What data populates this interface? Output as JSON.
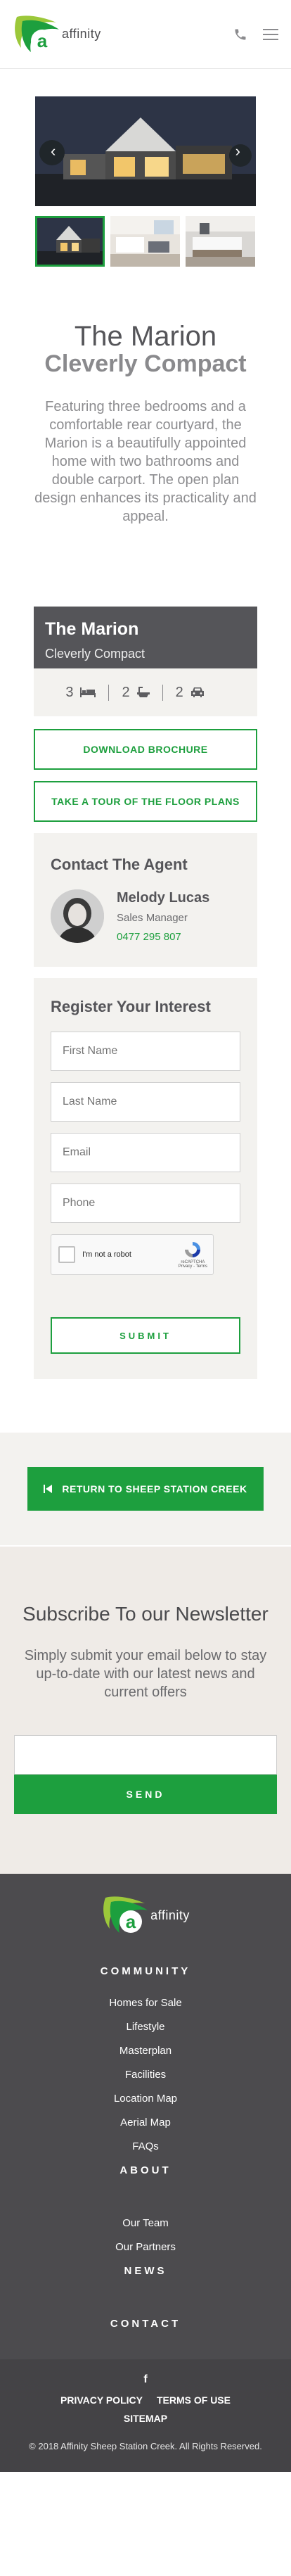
{
  "brand": {
    "name": "affinity",
    "accent": "#1d9f3e"
  },
  "header": {
    "phone_icon": "phone-icon",
    "menu_icon": "hamburger-icon"
  },
  "gallery": {
    "prev_icon": "chevron-left-icon",
    "next_icon": "chevron-right-icon",
    "thumbs": [
      "exterior-dusk",
      "living-room",
      "kitchen"
    ]
  },
  "intro": {
    "title": "The Marion",
    "subtitle": "Cleverly Compact",
    "description": "Featuring three bedrooms and a comfortable rear courtyard, the Marion is a beautifully appointed home with two bathrooms and double carport. The open plan design enhances its practicality and appeal."
  },
  "spec": {
    "title": "The Marion",
    "subtitle": "Cleverly Compact",
    "items": [
      {
        "value": "3",
        "icon": "bed-icon"
      },
      {
        "value": "2",
        "icon": "bath-icon"
      },
      {
        "value": "2",
        "icon": "car-icon"
      }
    ]
  },
  "actions": {
    "download": "DOWNLOAD BROCHURE",
    "tour": "TAKE A TOUR OF THE FLOOR PLANS"
  },
  "agent": {
    "heading": "Contact The Agent",
    "name": "Melody Lucas",
    "role": "Sales Manager",
    "phone": "0477 295 807"
  },
  "register": {
    "heading": "Register Your Interest",
    "fields": {
      "first": "First Name",
      "last": "Last Name",
      "email": "Email",
      "phone": "Phone"
    },
    "captcha_label": "I'm not a robot",
    "captcha_brand": "reCAPTCHA",
    "captcha_terms": "Privacy - Terms",
    "submit": "SUBMIT"
  },
  "return": {
    "label": "RETURN TO SHEEP STATION CREEK"
  },
  "newsletter": {
    "heading": "Subscribe To our Newsletter",
    "text": "Simply submit your email below to stay up-to-date with our latest news and current offers",
    "send": "SEND"
  },
  "footer": {
    "community_heading": "COMMUNITY",
    "community_links": [
      "Homes for Sale",
      "Lifestyle",
      "Masterplan",
      "Facilities",
      "Location Map",
      "Aerial Map",
      "FAQs"
    ],
    "about_heading": "ABOUT",
    "about_links": [
      "Our Team",
      "Our Partners"
    ],
    "news_heading": "NEWS",
    "contact_heading": "CONTACT",
    "facebook": "f",
    "privacy": "PRIVACY POLICY",
    "terms": "TERMS OF USE",
    "sitemap": "SITEMAP",
    "copyright": "© 2018 Affinity Sheep Station Creek. All Rights Reserved."
  }
}
